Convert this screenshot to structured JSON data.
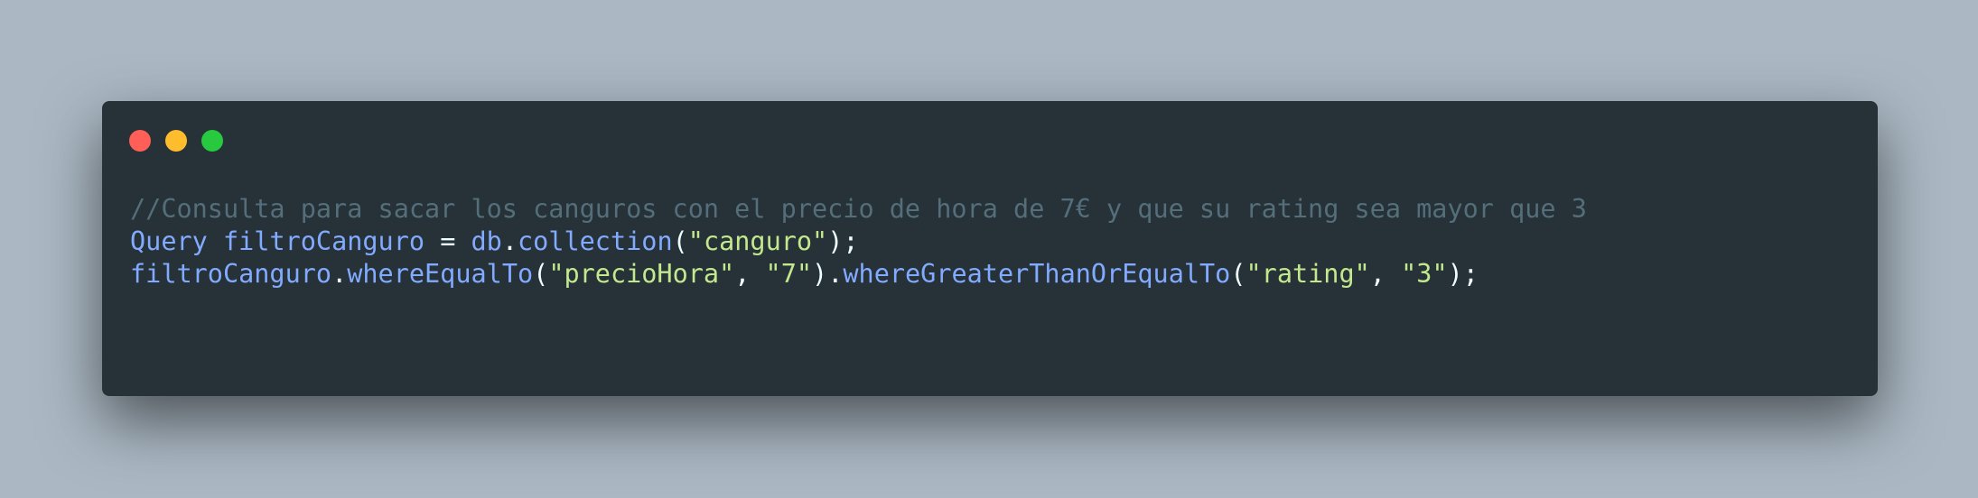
{
  "colors": {
    "background": "#abb8c3",
    "window": "#263238",
    "close": "#ff5f56",
    "minimize": "#ffbd2e",
    "maximize": "#27c93f",
    "comment": "#546e7a",
    "identifier": "#82aaff",
    "string": "#c3e88d",
    "punctuation": "#eeffff"
  },
  "window_controls": [
    "close",
    "minimize",
    "maximize"
  ],
  "code": {
    "line1": {
      "comment": "//Consulta para sacar los canguros con el precio de hora de 7€ y que su rating sea mayor que 3"
    },
    "line2": {
      "type": "Query",
      "sp1": " ",
      "var": "filtroCanguro",
      "assign": " = ",
      "obj": "db",
      "dot": ".",
      "method": "collection",
      "open": "(",
      "arg": "\"canguro\"",
      "close": ");"
    },
    "line3": {
      "var": "filtroCanguro",
      "dot1": ".",
      "method1": "whereEqualTo",
      "open1": "(",
      "arg1": "\"precioHora\"",
      "comma1": ", ",
      "arg2": "\"7\"",
      "close1": ")",
      "dot2": ".",
      "method2": "whereGreaterThanOrEqualTo",
      "open2": "(",
      "arg3": "\"rating\"",
      "comma2": ", ",
      "arg4": "\"3\"",
      "close2": ");"
    }
  }
}
